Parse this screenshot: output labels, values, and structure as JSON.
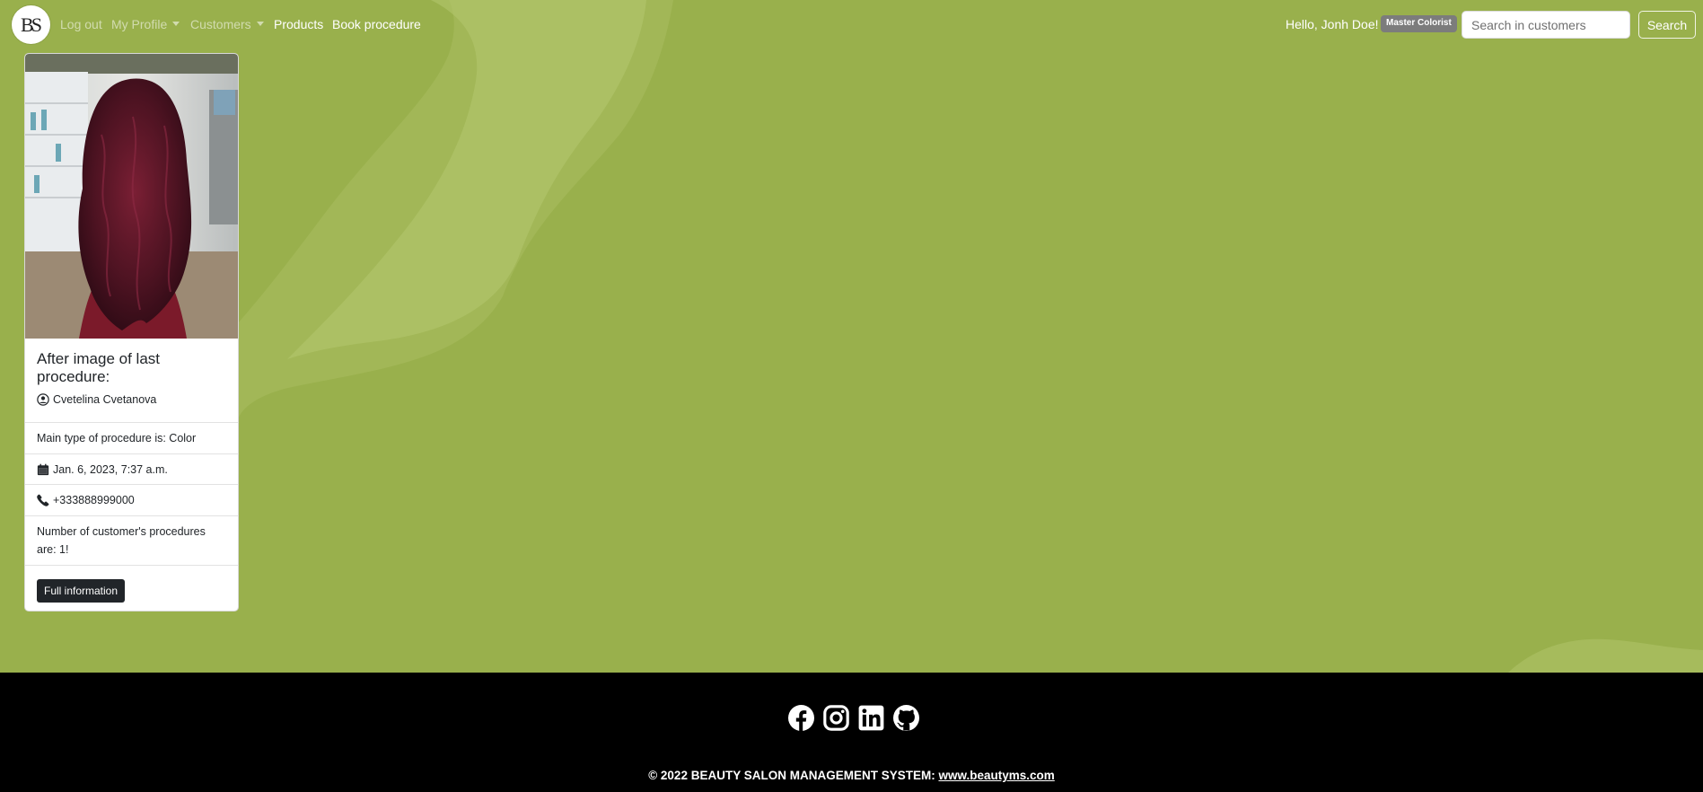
{
  "colors": {
    "background": "#99b04c",
    "footer": "#000000",
    "button_dark": "#212529",
    "badge": "#7c7c7c"
  },
  "navbar": {
    "logo_text": "BS",
    "links": [
      {
        "label": "Log out"
      },
      {
        "label": "My Profile"
      },
      {
        "label": "Customers"
      },
      {
        "label": "Products"
      },
      {
        "label": "Book procedure"
      }
    ],
    "greeting": "Hello, Jonh Doe!",
    "role_badge": "Master Colorist",
    "search": {
      "placeholder": "Search in customers",
      "value": "",
      "button_label": "Search"
    }
  },
  "card": {
    "image_icon": "hair-photo",
    "title": "After image of last procedure:",
    "customer_name": "Cvetelina Cvetanova",
    "procedure_type": "Main type of procedure is: Color",
    "date": "Jan. 6, 2023, 7:37 a.m.",
    "phone": "+333888999000",
    "procedures_count": "Number of customer's procedures are: 1!",
    "button_label": "Full information"
  },
  "footer": {
    "social_icons": [
      "facebook-icon",
      "instagram-icon",
      "linkedin-icon",
      "github-icon"
    ],
    "copyright_text": "© 2022 BEAUTY SALON MANAGEMENT SYSTEM:",
    "link_text": "www.beautyms.com"
  }
}
